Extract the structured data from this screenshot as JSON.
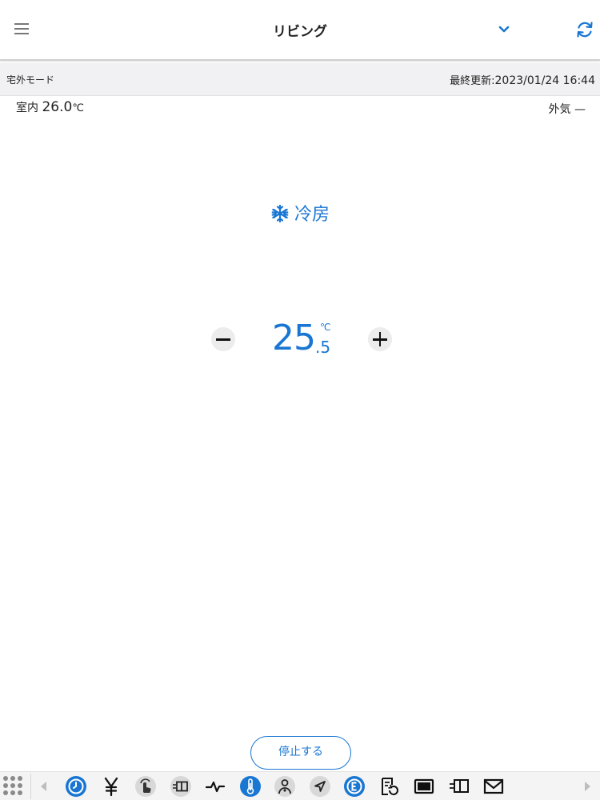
{
  "header": {
    "room_name": "リビング"
  },
  "status_bar": {
    "mode": "宅外モード",
    "last_updated_label": "最終更新:",
    "last_updated_value": "2023/01/24 16:44"
  },
  "readings": {
    "indoor_label": "室内",
    "indoor_value": "26.0",
    "indoor_unit": "℃",
    "outdoor_label": "外気",
    "outdoor_value": "—"
  },
  "operation": {
    "mode_label": "冷房",
    "setpoint_int": "25",
    "setpoint_dec": ".5",
    "setpoint_unit": "℃"
  },
  "actions": {
    "stop_label": "停止する"
  },
  "colors": {
    "accent": "#1976d2"
  },
  "dock": {
    "icons": [
      "apps-grid-icon",
      "clock-icon",
      "yen-icon",
      "touch-icon",
      "panel-icon",
      "pulse-icon",
      "thermometer-icon",
      "person-icon",
      "navigation-icon",
      "energy-icon",
      "history-icon",
      "monitor-icon",
      "device-icon",
      "mail-icon"
    ]
  }
}
